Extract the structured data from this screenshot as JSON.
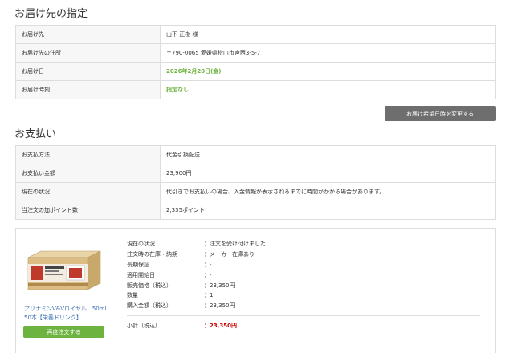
{
  "delivery": {
    "title": "お届け先の指定",
    "rows": [
      {
        "label": "お届け先",
        "value": "山下 正樹 様"
      },
      {
        "label": "お届け先の住所",
        "value": "〒790-0065 愛媛県松山市宮西3-5-7"
      },
      {
        "label": "お届け日",
        "value": "2026年2月20日(金)"
      },
      {
        "label": "お届け時刻",
        "value": "指定なし"
      }
    ],
    "change_button": "お届け希望日時を変更する"
  },
  "payment": {
    "title": "お支払い",
    "rows": [
      {
        "label": "お支払方法",
        "value": "代金引換配送"
      },
      {
        "label": "お支払い金額",
        "value": "23,900円"
      },
      {
        "label": "現在の状況",
        "value": "代引きでお支払いの場合、入金情報が表示されるまでに時間がかかる場合があります。"
      },
      {
        "label": "当注文の加ポイント数",
        "value": "2,335ポイント"
      }
    ]
  },
  "order": {
    "product_name": "アリナミンV&Vロイヤル　50ml 50本【栄養ドリンク】",
    "reorder_button": "再度注文する",
    "details": [
      {
        "key": "現在の状況",
        "value": "：注文を受け付けました"
      },
      {
        "key": "注文時の在庫・納期",
        "value": "：メーカー在庫あり"
      },
      {
        "key": "長期保証",
        "value": "：-"
      },
      {
        "key": "適用開始日",
        "value": "：-"
      },
      {
        "key": "販売価格（税込）",
        "value": "：23,350円"
      },
      {
        "key": "数量",
        "value": "：1"
      },
      {
        "key": "購入金額（税込）",
        "value": "：23,350円"
      }
    ],
    "subtotal_label": "小計（税込）",
    "subtotal_value": "：23,350円"
  },
  "colors": {
    "accent_green": "#6db33f",
    "subtotal_red": "#cc0000",
    "button_gray": "#6e6e6e",
    "link_blue": "#3a6fb5"
  }
}
